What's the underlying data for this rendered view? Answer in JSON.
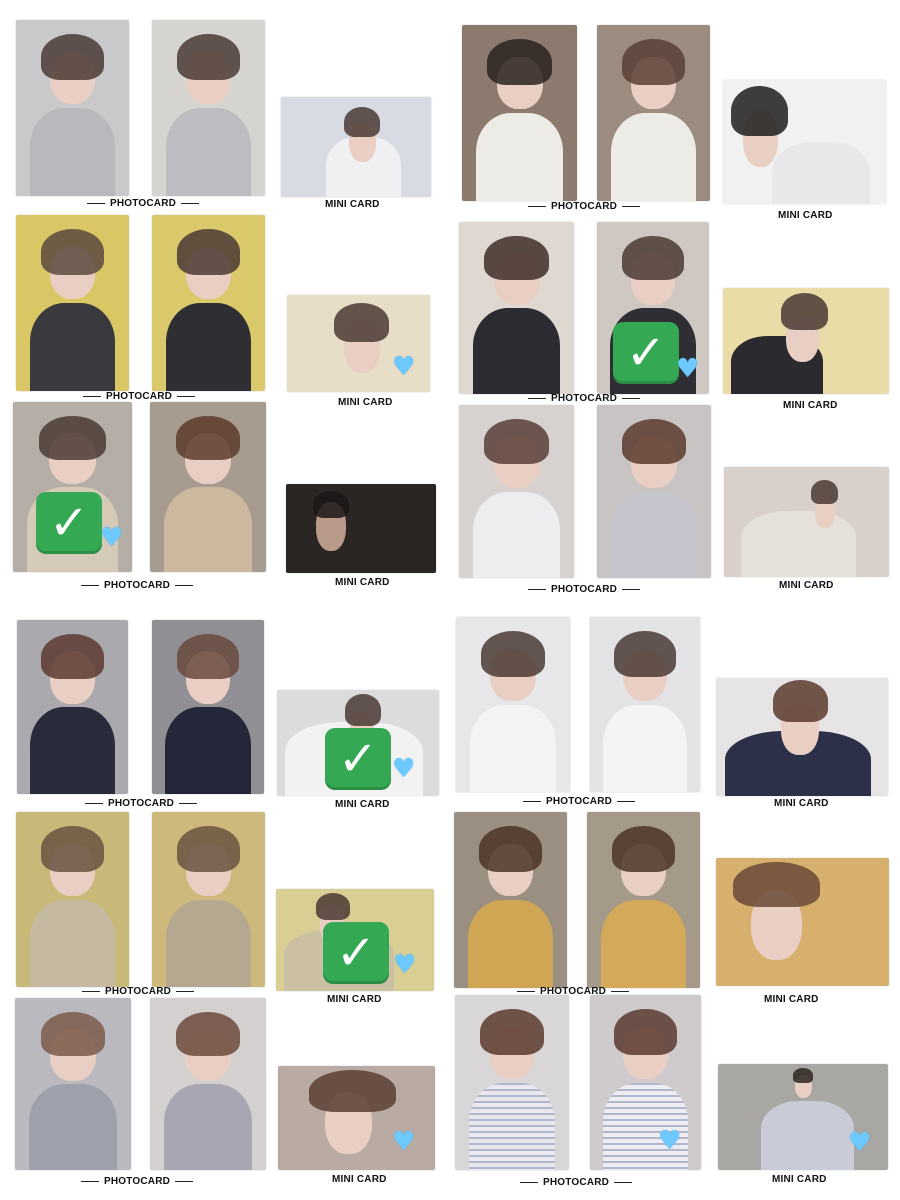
{
  "labels": {
    "photocard": "PHOTOCARD",
    "minicard": "MINI CARD"
  },
  "icons": {
    "check": "✓",
    "heart": "♥"
  },
  "colors": {
    "check_bg": "#34a853",
    "heart": "#6ec9ff"
  },
  "sets": [
    {
      "id": "set-1",
      "checks": [],
      "hearts": []
    },
    {
      "id": "set-2",
      "checks": [],
      "hearts": [
        "mini"
      ]
    },
    {
      "id": "set-3",
      "checks": [
        "photo1"
      ],
      "hearts": [
        "photo1"
      ]
    },
    {
      "id": "set-4",
      "checks": [],
      "hearts": []
    },
    {
      "id": "set-5",
      "checks": [
        "photo2"
      ],
      "hearts": [
        "photo2"
      ]
    },
    {
      "id": "set-6",
      "checks": [],
      "hearts": []
    },
    {
      "id": "set-7",
      "checks": [
        "mini"
      ],
      "hearts": [
        "mini"
      ]
    },
    {
      "id": "set-8",
      "checks": [
        "mini"
      ],
      "hearts": [
        "mini"
      ]
    },
    {
      "id": "set-9",
      "checks": [],
      "hearts": [
        "mini"
      ]
    },
    {
      "id": "set-10",
      "checks": [],
      "hearts": []
    },
    {
      "id": "set-11",
      "checks": [],
      "hearts": []
    },
    {
      "id": "set-12",
      "checks": [],
      "hearts": [
        "photo2",
        "mini"
      ]
    }
  ]
}
